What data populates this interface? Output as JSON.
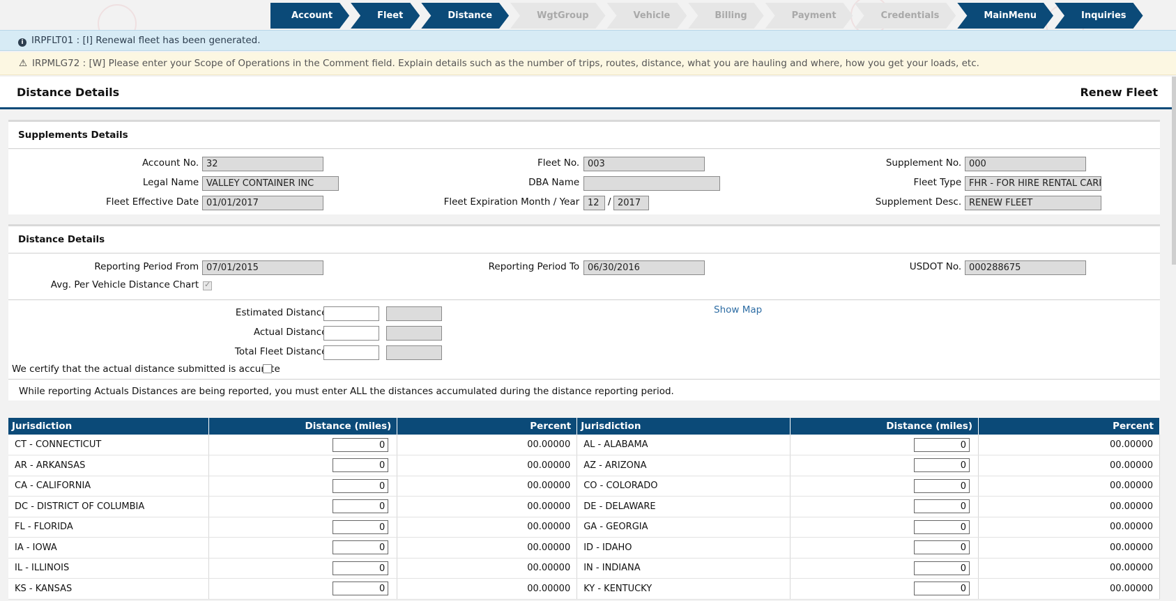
{
  "steps": [
    {
      "label": "Account",
      "state": "done"
    },
    {
      "label": "Fleet",
      "state": "done"
    },
    {
      "label": "Distance",
      "state": "current"
    },
    {
      "label": "WgtGroup",
      "state": "disabled"
    },
    {
      "label": "Vehicle",
      "state": "disabled"
    },
    {
      "label": "Billing",
      "state": "disabled"
    },
    {
      "label": "Payment",
      "state": "disabled"
    },
    {
      "label": "Credentials",
      "state": "disabled"
    },
    {
      "label": "MainMenu",
      "state": "done"
    },
    {
      "label": "Inquiries",
      "state": "done"
    }
  ],
  "messages": {
    "info": "IRPFLT01 : [I] Renewal fleet has been generated.",
    "warning": "IRPMLG72 : [W] Please enter your Scope of Operations in the Comment field. Explain details such as the number of trips, routes, distance, what you are hauling and where, how you get your loads, etc."
  },
  "header": {
    "title": "Distance Details",
    "action": "Renew Fleet"
  },
  "supplements": {
    "title": "Supplements Details",
    "account_no_label": "Account No. :",
    "account_no": "32",
    "fleet_no_label": "Fleet No. :",
    "fleet_no": "003",
    "supplement_no_label": "Supplement No. :",
    "supplement_no": "000",
    "legal_name_label": "Legal Name :",
    "legal_name": "VALLEY CONTAINER INC",
    "dba_name_label": "DBA Name :",
    "dba_name": "",
    "fleet_type_label": "Fleet Type :",
    "fleet_type": "FHR - FOR HIRE RENTAL CARRIE",
    "effective_date_label": "Fleet Effective Date :",
    "effective_date": "01/01/2017",
    "expiration_label": "Fleet Expiration Month / Year :",
    "exp_month": "12",
    "exp_sep": "/",
    "exp_year": "2017",
    "supplement_desc_label": "Supplement Desc. :",
    "supplement_desc": "RENEW FLEET"
  },
  "distance": {
    "title": "Distance Details",
    "period_from_label": "Reporting Period From :",
    "period_from": "07/01/2015",
    "period_to_label": "Reporting Period To :",
    "period_to": "06/30/2016",
    "usdot_label": "USDOT No. :",
    "usdot": "000288675",
    "avg_chart_label": "Avg. Per Vehicle Distance Chart :",
    "estimated_label": "Estimated Distance:",
    "actual_label": "Actual Distance:",
    "total_label": "Total Fleet Distance:",
    "show_map": "Show Map",
    "certify_label": "We certify that the actual distance submitted is accurate",
    "note": "While reporting Actuals Distances are being reported, you must enter ALL the distances accumulated during the distance reporting period."
  },
  "table": {
    "headers": [
      "Jurisdiction",
      "Distance (miles)",
      "Percent",
      "Jurisdiction",
      "Distance (miles)",
      "Percent"
    ],
    "rows": [
      {
        "j1": "CT - CONNECTICUT",
        "d1": "0",
        "p1": "00.00000",
        "j2": "AL - ALABAMA",
        "d2": "0",
        "p2": "00.00000"
      },
      {
        "j1": "AR - ARKANSAS",
        "d1": "0",
        "p1": "00.00000",
        "j2": "AZ - ARIZONA",
        "d2": "0",
        "p2": "00.00000"
      },
      {
        "j1": "CA - CALIFORNIA",
        "d1": "0",
        "p1": "00.00000",
        "j2": "CO - COLORADO",
        "d2": "0",
        "p2": "00.00000"
      },
      {
        "j1": "DC - DISTRICT OF COLUMBIA",
        "d1": "0",
        "p1": "00.00000",
        "j2": "DE - DELAWARE",
        "d2": "0",
        "p2": "00.00000"
      },
      {
        "j1": "FL - FLORIDA",
        "d1": "0",
        "p1": "00.00000",
        "j2": "GA - GEORGIA",
        "d2": "0",
        "p2": "00.00000"
      },
      {
        "j1": "IA - IOWA",
        "d1": "0",
        "p1": "00.00000",
        "j2": "ID - IDAHO",
        "d2": "0",
        "p2": "00.00000"
      },
      {
        "j1": "IL - ILLINOIS",
        "d1": "0",
        "p1": "00.00000",
        "j2": "IN - INDIANA",
        "d2": "0",
        "p2": "00.00000"
      },
      {
        "j1": "KS - KANSAS",
        "d1": "0",
        "p1": "00.00000",
        "j2": "KY - KENTUCKY",
        "d2": "0",
        "p2": "00.00000"
      }
    ]
  },
  "colors": {
    "primary": "#0b4a78",
    "info_bg": "#d7ebf5",
    "warn_bg": "#fcf7e2",
    "disabled_step": "#e6e6e6"
  }
}
